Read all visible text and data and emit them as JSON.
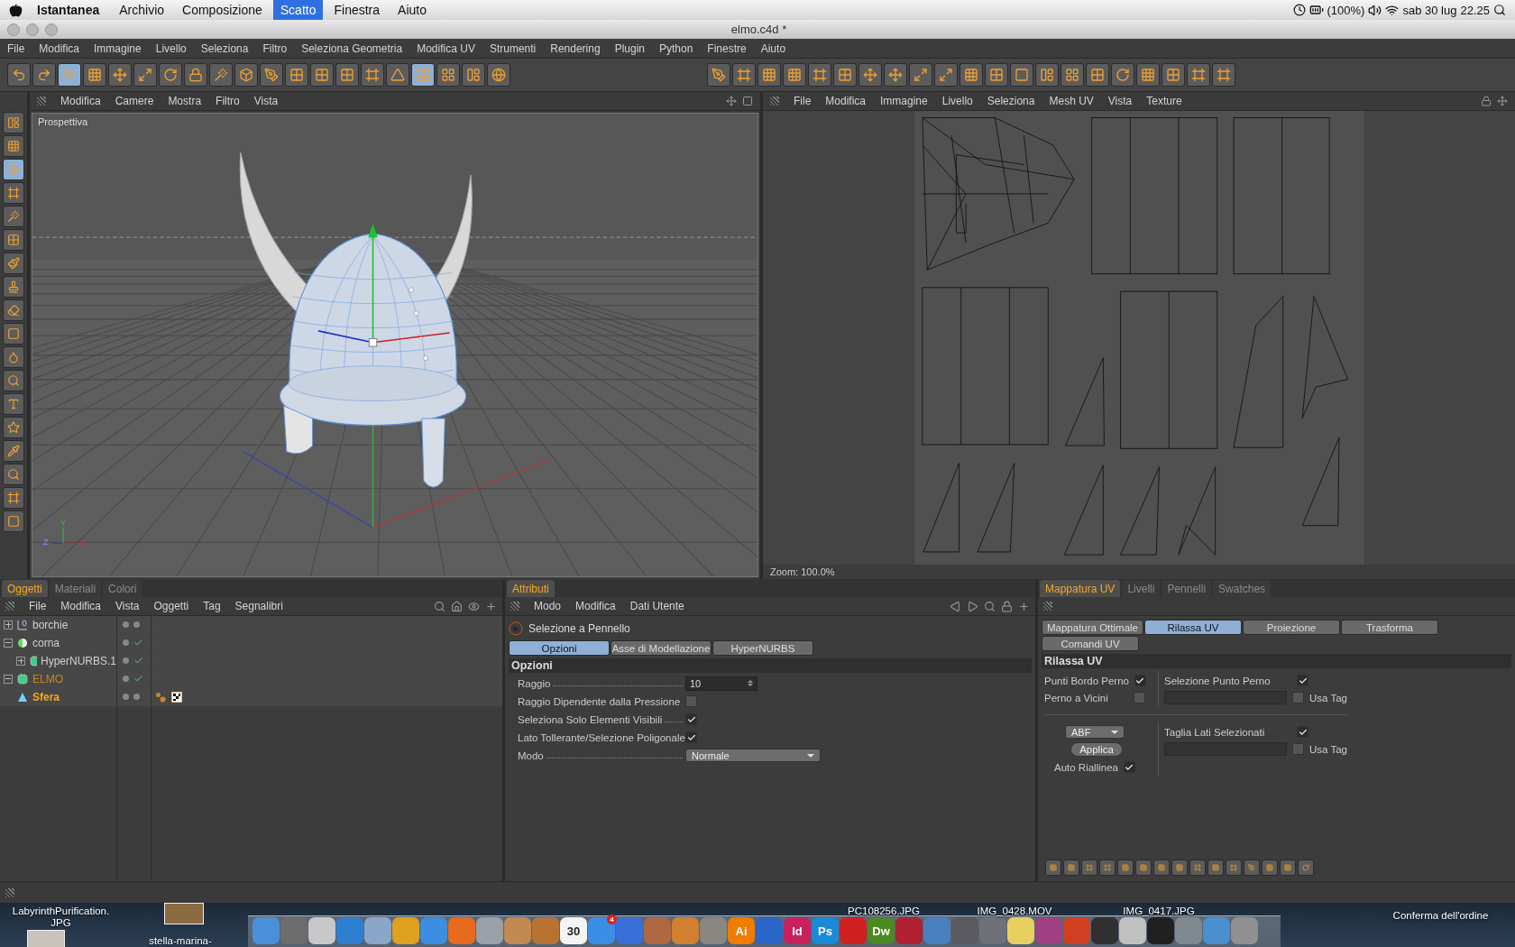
{
  "menubar": {
    "app": "Istantanea",
    "items": [
      {
        "label": "Archivio",
        "selected": false
      },
      {
        "label": "Composizione",
        "selected": false
      },
      {
        "label": "Scatto",
        "selected": true
      },
      {
        "label": "Finestra",
        "selected": false
      },
      {
        "label": "Aiuto",
        "selected": false
      }
    ],
    "battery": "(100%)",
    "date": "sab 30 lug",
    "time": "22.25"
  },
  "window": {
    "title": "elmo.c4d *"
  },
  "menu": [
    "File",
    "Modifica",
    "Immagine",
    "Livello",
    "Seleziona",
    "Filtro",
    "Seleziona Geometria",
    "Modifica UV",
    "Strumenti",
    "Rendering",
    "Plugin",
    "Python",
    "Finestre",
    "Aiuto"
  ],
  "toolbar_left": [
    {
      "kind": "undo",
      "selected": false
    },
    {
      "kind": "redo",
      "selected": false
    },
    {
      "kind": "pointer",
      "selected": true
    },
    {
      "kind": "grid",
      "selected": false
    },
    {
      "kind": "move",
      "selected": false
    },
    {
      "kind": "scale",
      "selected": false
    },
    {
      "kind": "rotate",
      "selected": false
    },
    {
      "kind": "lock",
      "selected": false
    },
    {
      "kind": "wand",
      "selected": false
    },
    {
      "kind": "cube",
      "selected": false
    },
    {
      "kind": "pen",
      "selected": false
    },
    {
      "kind": "checker",
      "selected": false
    },
    {
      "kind": "checker",
      "selected": false
    },
    {
      "kind": "checker",
      "selected": false
    },
    {
      "kind": "frame",
      "selected": false
    },
    {
      "kind": "triangle",
      "selected": false
    },
    {
      "kind": "layout",
      "selected": true
    },
    {
      "kind": "layout",
      "selected": false
    },
    {
      "kind": "panel",
      "selected": false
    },
    {
      "kind": "globe",
      "selected": false
    }
  ],
  "toolbar_right": [
    {
      "kind": "pen",
      "selected": false
    },
    {
      "kind": "frame",
      "selected": false
    },
    {
      "kind": "grid",
      "selected": false
    },
    {
      "kind": "grid",
      "selected": false
    },
    {
      "kind": "frame",
      "selected": false
    },
    {
      "kind": "checker",
      "selected": false
    },
    {
      "kind": "move",
      "selected": false
    },
    {
      "kind": "move",
      "selected": false
    },
    {
      "kind": "scale",
      "selected": false
    },
    {
      "kind": "scale",
      "selected": false
    },
    {
      "kind": "grid",
      "selected": false
    },
    {
      "kind": "checker",
      "selected": false
    },
    {
      "kind": "square",
      "selected": false
    },
    {
      "kind": "panel",
      "selected": false
    },
    {
      "kind": "layout",
      "selected": false
    },
    {
      "kind": "checker",
      "selected": false
    },
    {
      "kind": "rotate",
      "selected": false
    },
    {
      "kind": "grid",
      "selected": false
    },
    {
      "kind": "checker",
      "selected": false
    },
    {
      "kind": "frame",
      "selected": false
    },
    {
      "kind": "frame",
      "selected": false
    }
  ],
  "side_tools": [
    {
      "kind": "panel",
      "selected": false
    },
    {
      "kind": "grid",
      "selected": false
    },
    {
      "kind": "move",
      "selected": true
    },
    {
      "kind": "frame",
      "selected": false
    },
    {
      "kind": "wand",
      "selected": false
    },
    {
      "kind": "checker",
      "selected": false
    },
    {
      "kind": "brush",
      "selected": false
    },
    {
      "kind": "stamp",
      "selected": false
    },
    {
      "kind": "eraser",
      "selected": false
    },
    {
      "kind": "square",
      "selected": false
    },
    {
      "kind": "drop",
      "selected": false
    },
    {
      "kind": "search",
      "selected": false
    },
    {
      "kind": "text",
      "selected": false
    },
    {
      "kind": "star",
      "selected": false
    },
    {
      "kind": "pipette",
      "selected": false
    },
    {
      "kind": "search",
      "selected": false
    },
    {
      "kind": "frame",
      "selected": false
    },
    {
      "kind": "square",
      "selected": false
    }
  ],
  "viewport": {
    "menu": [
      "Modifica",
      "Camere",
      "Mostra",
      "Filtro",
      "Vista"
    ],
    "label": "Prospettiva",
    "axes": [
      "Y",
      "Z",
      "X"
    ]
  },
  "uv_editor": {
    "menu": [
      "File",
      "Modifica",
      "Immagine",
      "Livello",
      "Seleziona",
      "Mesh UV",
      "Vista",
      "Texture"
    ],
    "zoom": "Zoom: 100.0%"
  },
  "objects_panel": {
    "tabs": [
      {
        "label": "Oggetti",
        "selected": true
      },
      {
        "label": "Materiali",
        "selected": false
      },
      {
        "label": "Colori",
        "selected": false
      }
    ],
    "menu": [
      "File",
      "Modifica",
      "Vista",
      "Oggetti",
      "Tag",
      "Segnalibri"
    ],
    "objects": [
      {
        "name": "borchie",
        "kind": "null",
        "expanded": false,
        "enabled": false,
        "active": false,
        "selected": false
      },
      {
        "name": "corna",
        "kind": "sphere",
        "expanded": true,
        "enabled": true,
        "active": false,
        "selected": false,
        "children": [
          {
            "name": "HyperNURBS.1",
            "kind": "nurbs",
            "expanded": false,
            "enabled": true,
            "active": false,
            "selected": false
          }
        ]
      },
      {
        "name": "ELMO",
        "kind": "nurbs",
        "expanded": true,
        "enabled": true,
        "active": true,
        "selected": false,
        "children": [
          {
            "name": "Sfera",
            "kind": "cone",
            "enabled": false,
            "active": false,
            "selected": true,
            "tags": [
              {
                "kind": "phong"
              },
              {
                "kind": "texture"
              }
            ]
          }
        ]
      }
    ]
  },
  "attributes_panel": {
    "tabs": [
      {
        "label": "Attributi",
        "selected": true
      }
    ],
    "menu": [
      "Modo",
      "Modifica",
      "Dati Utente"
    ],
    "tool": "Selezione a Pennello",
    "subtabs": [
      {
        "label": "Opzioni",
        "selected": true
      },
      {
        "label": "Asse di Modellazione",
        "selected": false
      },
      {
        "label": "HyperNURBS",
        "selected": false
      }
    ],
    "section": "Opzioni",
    "fields": [
      {
        "kind": "number",
        "label": "Raggio",
        "value": "10"
      },
      {
        "kind": "checkbox",
        "label": "Raggio Dipendente dalla Pressione",
        "checked": false
      },
      {
        "kind": "checkbox",
        "label": "Seleziona Solo Elementi Visibili",
        "checked": true
      },
      {
        "kind": "checkbox",
        "label": "Lato Tollerante/Selezione Poligonale",
        "checked": true
      },
      {
        "kind": "dropdown",
        "label": "Modo",
        "value": "Normale"
      }
    ]
  },
  "uv_panel": {
    "tabs": [
      {
        "label": "Mappatura UV",
        "selected": true
      },
      {
        "label": "Livelli",
        "selected": false
      },
      {
        "label": "Pennelli",
        "selected": false
      },
      {
        "label": "Swatches",
        "selected": false
      }
    ],
    "subtabs": [
      {
        "label": "Mappatura Ottimale",
        "selected": false
      },
      {
        "label": "Rilassa UV",
        "selected": true
      },
      {
        "label": "Proiezione",
        "selected": false
      },
      {
        "label": "Trasforma",
        "selected": false
      },
      {
        "label": "Comandi UV",
        "selected": false
      }
    ],
    "section": "Rilassa UV",
    "pin_options": [
      {
        "label": "Punti Bordo Perno",
        "checked": true
      },
      {
        "label": "Perno a Vicini",
        "checked": false
      }
    ],
    "selection_options": [
      {
        "label": "Selezione Punto Perno",
        "checked": true,
        "tag_label": "Usa Tag",
        "use_tag": false
      },
      {
        "label": "Taglia Lati Selezionati",
        "checked": true,
        "tag_label": "Usa Tag",
        "use_tag": false
      }
    ],
    "method": "ABF",
    "apply": "Applica",
    "auto_realign": {
      "label": "Auto Riallinea",
      "checked": true
    },
    "tools": [
      {
        "kind": "grid"
      },
      {
        "kind": "grid"
      },
      {
        "kind": "frame"
      },
      {
        "kind": "frame"
      },
      {
        "kind": "grid"
      },
      {
        "kind": "grid"
      },
      {
        "kind": "grid"
      },
      {
        "kind": "grid"
      },
      {
        "kind": "frame"
      },
      {
        "kind": "grid"
      },
      {
        "kind": "frame"
      },
      {
        "kind": "pen"
      },
      {
        "kind": "grid"
      },
      {
        "kind": "grid"
      },
      {
        "kind": "rotate"
      }
    ]
  },
  "desktop_files": [
    {
      "lines": [
        "LabyrinthPurification.",
        "JPG"
      ],
      "has_thumb": true
    },
    {
      "lines": [
        "stella-marina-"
      ],
      "has_thumb": true
    },
    {
      "lines": [
        "PC108256.JPG"
      ]
    },
    {
      "lines": [
        "IMG_0428.MOV"
      ]
    },
    {
      "lines": [
        "IMG_0417.JPG"
      ]
    },
    {
      "lines": [
        "Conferma dell'ordine"
      ]
    }
  ],
  "dock": [
    {
      "color": "#4a90d9"
    },
    {
      "color": "#6d6d6d"
    },
    {
      "color": "#c8c8c8"
    },
    {
      "color": "#2f7fd0"
    },
    {
      "color": "#8aa6c8"
    },
    {
      "color": "#e0a020"
    },
    {
      "color": "#3b8ee0"
    },
    {
      "color": "#e86a1c"
    },
    {
      "color": "#9aa0a8"
    },
    {
      "color": "#c08a50"
    },
    {
      "color": "#b87333"
    },
    {
      "label": "30",
      "color": "#f4f4f4"
    },
    {
      "color": "#3a8ee6",
      "badge": "4"
    },
    {
      "color": "#3a6fd8"
    },
    {
      "color": "#b06840"
    },
    {
      "color": "#d08030"
    },
    {
      "color": "#888880"
    },
    {
      "label": "Ai",
      "color": "#f07c00"
    },
    {
      "color": "#2a66c8"
    },
    {
      "label": "Id",
      "color": "#c8205e"
    },
    {
      "label": "Ps",
      "color": "#1b8ad8"
    },
    {
      "color": "#d02020"
    },
    {
      "label": "Dw",
      "color": "#4a8a20"
    },
    {
      "color": "#b02030"
    },
    {
      "color": "#4a80c0"
    },
    {
      "color": "#5a5a60"
    },
    {
      "color": "#707078"
    },
    {
      "color": "#e8d060"
    },
    {
      "color": "#a04080"
    },
    {
      "color": "#d04020"
    },
    {
      "color": "#303030"
    },
    {
      "color": "#c0c0c0"
    },
    {
      "color": "#202020"
    },
    {
      "color": "#808890"
    },
    {
      "color": "#4a90d0"
    },
    {
      "color": "#909090"
    }
  ]
}
